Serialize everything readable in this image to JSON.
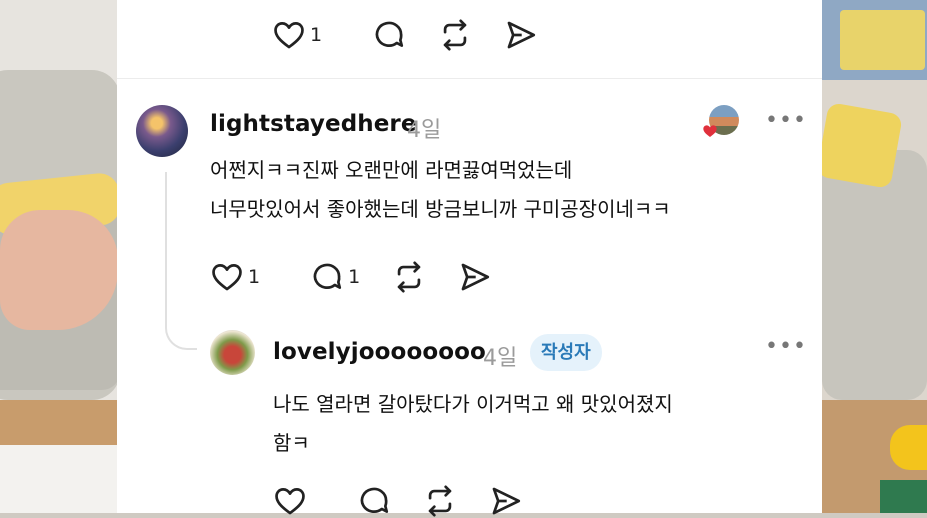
{
  "top_actions": {
    "like_count": "1"
  },
  "comment": {
    "username": "lightstayedhere",
    "time": "4일",
    "lines": [
      "어쩐지ㅋㅋ진짜 오랜만에 라면끓여먹었는데",
      "너무맛있어서 좋아했는데 방금보니까 구미공장이네ㅋㅋ"
    ],
    "like_count": "1",
    "reply_count": "1",
    "more": "•••"
  },
  "reply": {
    "username": "lovelyjoooooooo",
    "time": "4일",
    "badge": "작성자",
    "lines": [
      "나도  열라면 갈아탔다가  이거먹고 왜 맛있어졌지",
      "함ㅋ"
    ],
    "more": "•••"
  },
  "colors": {
    "accent_badge_bg": "#e5f2fb",
    "accent_badge_text": "#2a7ab8",
    "heart": "#e0303c"
  },
  "icons": [
    "heart-icon",
    "comment-icon",
    "repost-icon",
    "send-icon",
    "more-icon"
  ]
}
